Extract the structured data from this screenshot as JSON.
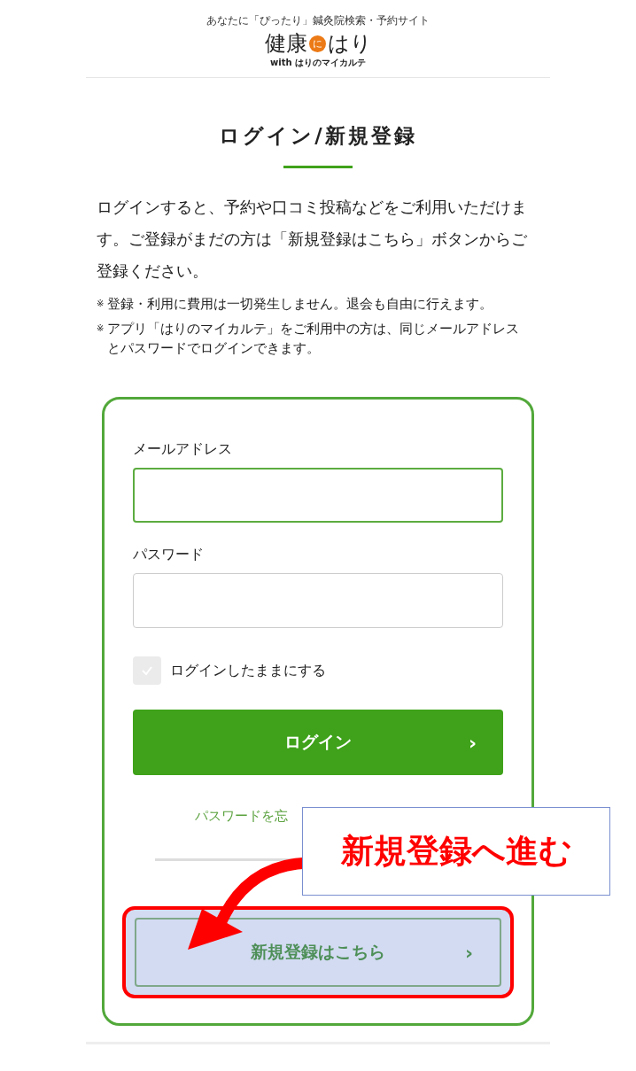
{
  "header": {
    "tagline": "あなたに「ぴったり」鍼灸院検索・予約サイト",
    "logo": {
      "before": "健康",
      "badge": "に",
      "after": "はり",
      "sub": "with はりのマイカルテ"
    }
  },
  "page_title": "ログイン/新規登録",
  "intro": "ログインすると、予約や口コミ投稿などをご利用いただけます。ご登録がまだの方は「新規登録はこちら」ボタンからご登録ください。",
  "notes": [
    {
      "mark": "※",
      "text": "登録・利用に費用は一切発生しません。退会も自由に行えます。"
    },
    {
      "mark": "※",
      "text": "アプリ「はりのマイカルテ」をご利用中の方は、同じメールアドレスとパスワードでログインできます。"
    }
  ],
  "form": {
    "fields": [
      {
        "label": "メールアドレス",
        "focused": true
      },
      {
        "label": "パスワード",
        "focused": false
      }
    ],
    "remember": {
      "label": "ログインしたままにする",
      "checked": false
    },
    "login_button": {
      "label": "ログイン",
      "chevron": "›"
    },
    "forgot_link": "パスワードを忘",
    "register_button": {
      "label": "新規登録はこちら",
      "chevron": "›",
      "highlighted": true
    }
  },
  "annotation": {
    "text": "新規登録へ進む"
  }
}
